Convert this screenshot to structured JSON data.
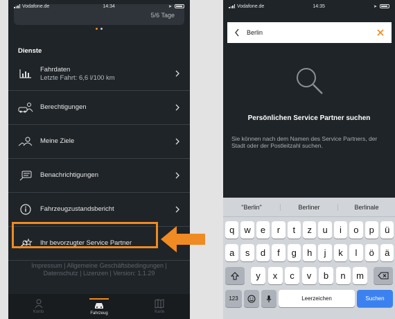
{
  "left_screen": {
    "status": {
      "carrier": "Vodafone.de",
      "time": "14:34"
    },
    "top_card_value": "5/6 Tage",
    "section_title": "Dienste",
    "items": [
      {
        "icon": "bar-chart-icon",
        "label": "Fahrdaten",
        "sublabel": "Letzte Fahrt: 6,6 l/100 km"
      },
      {
        "icon": "permissions-icon",
        "label": "Berechtigungen"
      },
      {
        "icon": "destinations-icon",
        "label": "Meine Ziele"
      },
      {
        "icon": "notifications-icon",
        "label": "Benachrichtigungen"
      },
      {
        "icon": "info-icon",
        "label": "Fahrzeugzustandsbericht"
      },
      {
        "icon": "service-partner-icon",
        "label": "Ihr bevorzugter Service Partner"
      }
    ],
    "footer": "Impressum | Allgemeine Geschäftsbedingungen | Datenschutz | Lizenzen | Version: 1.1.29",
    "tabs": [
      {
        "icon": "person-icon",
        "label": "Konto"
      },
      {
        "icon": "car-icon",
        "label": "Fahrzeug",
        "active": true
      },
      {
        "icon": "map-icon",
        "label": "Karte"
      }
    ]
  },
  "annotation": {
    "highlight_color": "#f08a22",
    "arrow_color": "#f08a22"
  },
  "right_screen": {
    "status": {
      "carrier": "Vodafone.de",
      "time": "14:35"
    },
    "search": {
      "value": "Berlin"
    },
    "title": "Persönlichen Service Partner suchen",
    "description": "Sie können nach dem Namen des Service Partners, der Stadt oder der Postleitzahl suchen.",
    "suggestions": [
      "\"Berlin\"",
      "Berliner",
      "Berlinale"
    ],
    "keyboard": {
      "row1": [
        "q",
        "w",
        "e",
        "r",
        "t",
        "z",
        "u",
        "i",
        "o",
        "p",
        "ü"
      ],
      "row2": [
        "a",
        "s",
        "d",
        "f",
        "g",
        "h",
        "j",
        "k",
        "l",
        "ö",
        "ä"
      ],
      "row3": [
        "y",
        "x",
        "c",
        "v",
        "b",
        "n",
        "m"
      ],
      "numbers_key": "123",
      "space_key": "Leerzeichen",
      "return_key": "Suchen"
    }
  },
  "colors": {
    "background": "#1f2428",
    "accent": "#f08a22",
    "keyboard_blue": "#3b82f0"
  }
}
